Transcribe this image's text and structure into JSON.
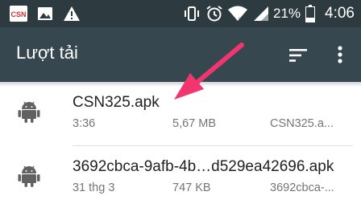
{
  "status_bar": {
    "icons": [
      "csn-app-icon",
      "image-icon",
      "warning-icon",
      "vibrate-icon",
      "alarm-icon",
      "wifi-icon",
      "signal-icon",
      "battery-icon"
    ],
    "csn_logo_text": "CSN",
    "battery": "21%",
    "time": "4:06"
  },
  "app_bar": {
    "title": "Lượt tải",
    "actions": [
      "sort-icon",
      "more-vert-icon"
    ]
  },
  "downloads": [
    {
      "name": "CSN325.apk",
      "date": "3:36",
      "size": "5,67 MB",
      "source": "CSN325.a..."
    },
    {
      "name": "3692cbca-9afb-4b…d529ea42696.apk",
      "date": "31 thg 3",
      "size": "747 KB",
      "source": "3692cbca-..."
    }
  ],
  "colors": {
    "status_bar": "#2d3a40",
    "app_bar": "#37474f",
    "annotation_arrow": "#f2356f",
    "android_icon": "#616161"
  }
}
